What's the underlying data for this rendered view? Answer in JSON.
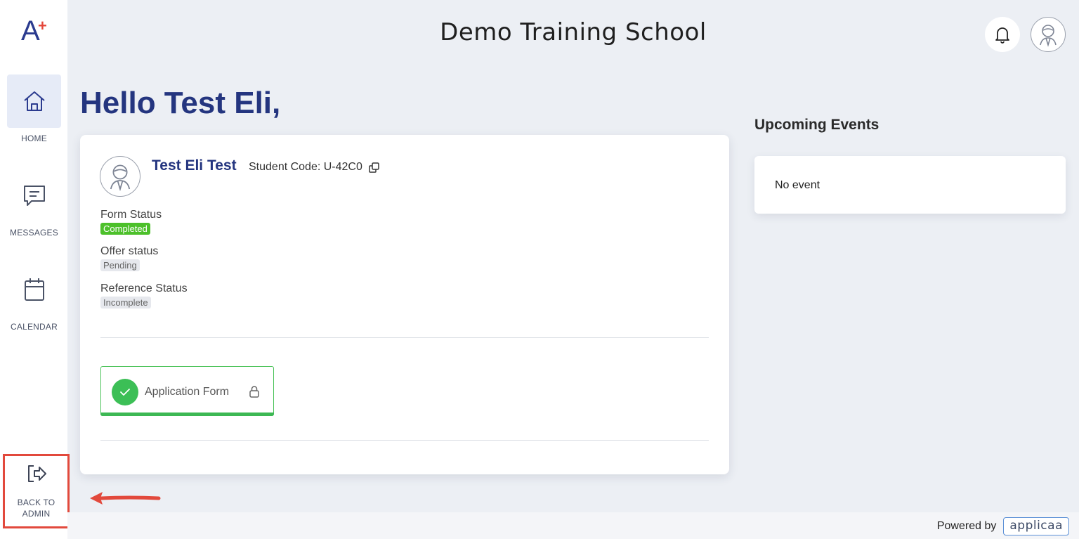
{
  "app": {
    "title": "Demo Training School",
    "logo": "A",
    "logo_plus": "+"
  },
  "sidebar": {
    "items": [
      {
        "label": "HOME",
        "icon": "home-icon",
        "active": true
      },
      {
        "label": "MESSAGES",
        "icon": "message-icon",
        "active": false
      },
      {
        "label": "CALENDAR",
        "icon": "calendar-icon",
        "active": false
      }
    ],
    "back_to_admin": {
      "line1": "BACK TO",
      "line2": "ADMIN",
      "icon": "logout-arrow-icon"
    }
  },
  "header": {
    "bell_icon": "bell-icon",
    "avatar_icon": "user-avatar-icon"
  },
  "main": {
    "greeting": "Hello Test Eli,",
    "student": {
      "name": "Test Eli Test",
      "code_text": "Student Code: U-42C0"
    },
    "statuses": [
      {
        "label": "Form Status",
        "badge": "Completed",
        "color": "#4cc02a"
      },
      {
        "label": "Offer status",
        "badge": "Pending",
        "color": "#e6e8ed"
      },
      {
        "label": "Reference Status",
        "badge": "Incomplete",
        "color": "#e6e8ed"
      }
    ],
    "application_form": {
      "label": "Application Form"
    }
  },
  "events": {
    "title": "Upcoming Events",
    "empty_text": "No event"
  },
  "footer": {
    "powered_by": "Powered by",
    "brand": "applicaa"
  },
  "colors": {
    "primary": "#24357f",
    "accent": "#e4473a",
    "success": "#3cbf56",
    "highlight": "#e2493c"
  }
}
